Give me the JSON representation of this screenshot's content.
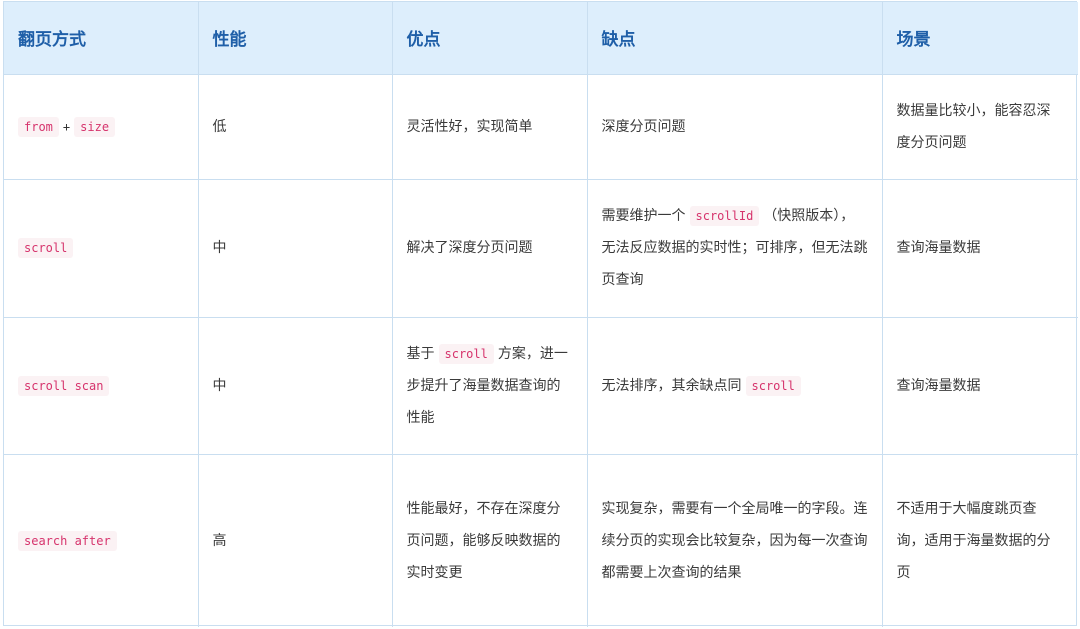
{
  "headers": {
    "method": "翻页方式",
    "performance": "性能",
    "pros": "优点",
    "cons": "缺点",
    "scenario": "场景"
  },
  "rows": [
    {
      "method_a": "from",
      "method_plus": "+",
      "method_b": "size",
      "performance": "低",
      "pros": "灵活性好，实现简单",
      "cons": "深度分页问题",
      "scenario": "数据量比较小，能容忍深度分页问题"
    },
    {
      "method": "scroll",
      "performance": "中",
      "pros": "解决了深度分页问题",
      "cons_prefix": "需要维护一个",
      "cons_code": "scrollId",
      "cons_suffix": "（快照版本），无法反应数据的实时性；可排序，但无法跳页查询",
      "scenario": "查询海量数据"
    },
    {
      "method": "scroll scan",
      "performance": "中",
      "pros_prefix": "基于",
      "pros_code": "scroll",
      "pros_suffix": "方案，进一步提升了海量数据查询的性能",
      "cons_prefix": "无法排序，其余缺点同",
      "cons_code": "scroll",
      "scenario": "查询海量数据"
    },
    {
      "method": "search after",
      "performance": "高",
      "pros": "性能最好，不存在深度分页问题，能够反映数据的实时变更",
      "cons": "实现复杂，需要有一个全局唯一的字段。连续分页的实现会比较复杂，因为每一次查询都需要上次查询的结果",
      "scenario": "不适用于大幅度跳页查询，适用于海量数据的分页"
    }
  ]
}
